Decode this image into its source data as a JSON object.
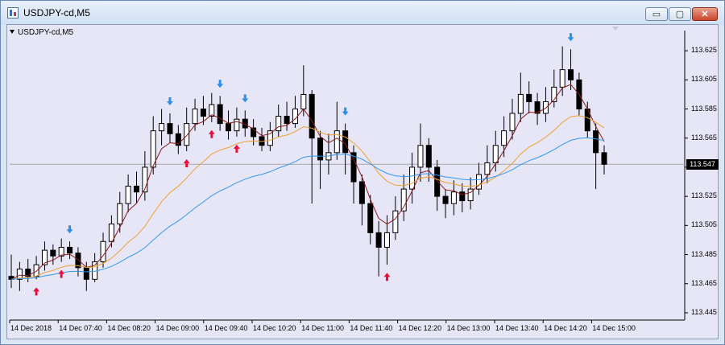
{
  "window": {
    "title": "USDJPY-cd,M5"
  },
  "title_buttons": {
    "minimize": "▭",
    "maximize": "▢",
    "close": "✕"
  },
  "chart": {
    "symbol_label": "USDJPY-cd,M5",
    "current_price": "113.547"
  },
  "chart_data": {
    "type": "candlestick",
    "ylim": [
      113.44,
      113.635
    ],
    "price_ticks": [
      "113.625",
      "113.605",
      "113.585",
      "113.565",
      "113.545",
      "113.525",
      "113.505",
      "113.485",
      "113.465",
      "113.445"
    ],
    "time_ticks": [
      "14 Dec 2018",
      "14 Dec 07:40",
      "14 Dec 08:20",
      "14 Dec 09:00",
      "14 Dec 09:40",
      "14 Dec 10:20",
      "14 Dec 11:00",
      "14 Dec 11:40",
      "14 Dec 12:20",
      "14 Dec 13:00",
      "14 Dec 13:40",
      "14 Dec 14:20",
      "14 Dec 15:00"
    ],
    "indicator_colors": {
      "fast_ma": "#8b1a1a",
      "mid_ma": "#f0a030",
      "slow_ma": "#3399ee",
      "up_arrow": "#e8103a",
      "down_arrow": "#2f8fe8"
    },
    "candles": [
      [
        113.47,
        113.468,
        113.485,
        113.462
      ],
      [
        113.468,
        113.475,
        113.48,
        113.46
      ],
      [
        113.475,
        113.47,
        113.482,
        113.466
      ],
      [
        113.47,
        113.478,
        113.484,
        113.468
      ],
      [
        113.478,
        113.488,
        113.494,
        113.474
      ],
      [
        113.488,
        113.484,
        113.492,
        113.478
      ],
      [
        113.484,
        113.49,
        113.496,
        113.48
      ],
      [
        113.49,
        113.486,
        113.494,
        113.482
      ],
      [
        113.486,
        113.476,
        113.49,
        113.47
      ],
      [
        113.476,
        113.468,
        113.48,
        113.46
      ],
      [
        113.468,
        113.48,
        113.486,
        113.466
      ],
      [
        113.48,
        113.494,
        113.5,
        113.476
      ],
      [
        113.494,
        113.506,
        113.512,
        113.49
      ],
      [
        113.506,
        113.52,
        113.528,
        113.5
      ],
      [
        113.52,
        113.532,
        113.54,
        113.514
      ],
      [
        113.532,
        113.528,
        113.542,
        113.52
      ],
      [
        113.528,
        113.545,
        113.556,
        113.522
      ],
      [
        113.545,
        113.57,
        113.58,
        113.54
      ],
      [
        113.57,
        113.575,
        113.585,
        113.56
      ],
      [
        113.575,
        113.568,
        113.582,
        113.562
      ],
      [
        113.568,
        113.56,
        113.574,
        113.554
      ],
      [
        113.56,
        113.575,
        113.586,
        113.556
      ],
      [
        113.575,
        113.585,
        113.592,
        113.57
      ],
      [
        113.585,
        113.58,
        113.594,
        113.574
      ],
      [
        113.58,
        113.588,
        113.596,
        113.576
      ],
      [
        113.588,
        113.575,
        113.594,
        113.57
      ],
      [
        113.575,
        113.57,
        113.584,
        113.564
      ],
      [
        113.57,
        113.578,
        113.586,
        113.566
      ],
      [
        113.578,
        113.572,
        113.584,
        113.566
      ],
      [
        113.572,
        113.566,
        113.578,
        113.56
      ],
      [
        113.566,
        113.56,
        113.572,
        113.556
      ],
      [
        113.56,
        113.57,
        113.576,
        113.556
      ],
      [
        113.57,
        113.58,
        113.588,
        113.566
      ],
      [
        113.58,
        113.575,
        113.59,
        113.57
      ],
      [
        113.575,
        113.585,
        113.594,
        113.572
      ],
      [
        113.585,
        113.595,
        113.615,
        113.58
      ],
      [
        113.595,
        113.565,
        113.598,
        113.52
      ],
      [
        113.565,
        113.55,
        113.57,
        113.53
      ],
      [
        113.55,
        113.555,
        113.568,
        113.54
      ],
      [
        113.555,
        113.57,
        113.59,
        113.55
      ],
      [
        113.57,
        113.555,
        113.575,
        113.54
      ],
      [
        113.555,
        113.535,
        113.56,
        113.52
      ],
      [
        113.535,
        113.52,
        113.54,
        113.505
      ],
      [
        113.52,
        113.5,
        113.526,
        113.492
      ],
      [
        113.5,
        113.49,
        113.508,
        113.47
      ],
      [
        113.49,
        113.5,
        113.512,
        113.478
      ],
      [
        113.5,
        113.515,
        113.525,
        113.495
      ],
      [
        113.515,
        113.53,
        113.54,
        113.508
      ],
      [
        113.53,
        113.545,
        113.555,
        113.52
      ],
      [
        113.545,
        113.56,
        113.575,
        113.535
      ],
      [
        113.56,
        113.545,
        113.565,
        113.535
      ],
      [
        113.545,
        113.525,
        113.55,
        113.515
      ],
      [
        113.525,
        113.52,
        113.53,
        113.51
      ],
      [
        113.52,
        113.528,
        113.536,
        113.512
      ],
      [
        113.528,
        113.522,
        113.534,
        113.514
      ],
      [
        113.522,
        113.53,
        113.538,
        113.516
      ],
      [
        113.53,
        113.54,
        113.548,
        113.526
      ],
      [
        113.54,
        113.548,
        113.56,
        113.534
      ],
      [
        113.548,
        113.56,
        113.57,
        113.542
      ],
      [
        113.56,
        113.57,
        113.58,
        113.552
      ],
      [
        113.57,
        113.582,
        113.592,
        113.564
      ],
      [
        113.582,
        113.595,
        113.61,
        113.576
      ],
      [
        113.595,
        113.59,
        113.604,
        113.582
      ],
      [
        113.59,
        113.582,
        113.596,
        113.574
      ],
      [
        113.582,
        113.59,
        113.6,
        113.576
      ],
      [
        113.59,
        113.6,
        113.612,
        113.586
      ],
      [
        113.6,
        113.612,
        113.628,
        113.594
      ],
      [
        113.612,
        113.605,
        113.626,
        113.598
      ],
      [
        113.605,
        113.585,
        113.61,
        113.58
      ],
      [
        113.585,
        113.57,
        113.59,
        113.565
      ],
      [
        113.57,
        113.555,
        113.575,
        113.53
      ],
      [
        113.555,
        113.547,
        113.56,
        113.54
      ]
    ]
  }
}
